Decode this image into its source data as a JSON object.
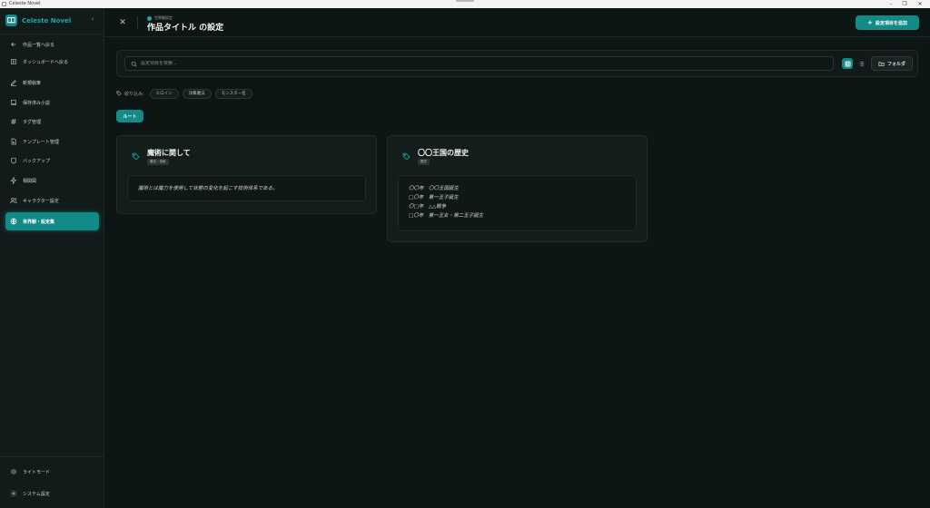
{
  "window": {
    "title": "Celeste Novel"
  },
  "sidebar": {
    "brand": "Celeste Novel",
    "items": [
      {
        "label": "作品一覧へ戻る",
        "icon": "arrow-left-icon"
      },
      {
        "label": "ダッシュボードへ戻る",
        "icon": "dashboard-icon"
      },
      {
        "label": "新規執筆",
        "icon": "pen-icon"
      },
      {
        "label": "保存済み小説",
        "icon": "book-icon"
      },
      {
        "label": "タグ管理",
        "icon": "hash-icon"
      },
      {
        "label": "テンプレート管理",
        "icon": "file-icon"
      },
      {
        "label": "バックアップ",
        "icon": "shield-icon"
      },
      {
        "label": "相関図",
        "icon": "network-icon"
      },
      {
        "label": "キャラクター設定",
        "icon": "users-icon"
      },
      {
        "label": "世界観・設定集",
        "icon": "globe-icon",
        "active": true
      }
    ],
    "bottom": [
      {
        "label": "ライトモード",
        "icon": "sun-icon"
      },
      {
        "label": "システム設定",
        "icon": "gear-icon"
      }
    ]
  },
  "header": {
    "breadcrumb": "世界観設定",
    "title": "作品タイトル の設定",
    "add_label": "設定項目を追加"
  },
  "search": {
    "placeholder": "設定項目を検索...",
    "folder_label": "フォルダ"
  },
  "filter": {
    "label": "絞り込み:",
    "tags": [
      "ヒロイン",
      "攻撃魔法",
      "モンスター名"
    ]
  },
  "root_label": "ルート",
  "cards": [
    {
      "title": "魔術に関して",
      "badge": "魔法・技術",
      "lines": [
        "魔術とは魔力を使用して状態の変化を起こす技術体系である。"
      ]
    },
    {
      "title": "〇〇王国の歴史",
      "badge": "歴史",
      "lines": [
        "〇〇年　〇〇王国誕生",
        "□〇年　第一王子誕生",
        "〇□年　△△戦争",
        "□〇年　第一王女・第二王子誕生"
      ]
    }
  ],
  "colors": {
    "accent": "#128a88",
    "bg": "#0e1615",
    "sidebar": "#121b1a",
    "card": "#131d1c"
  }
}
